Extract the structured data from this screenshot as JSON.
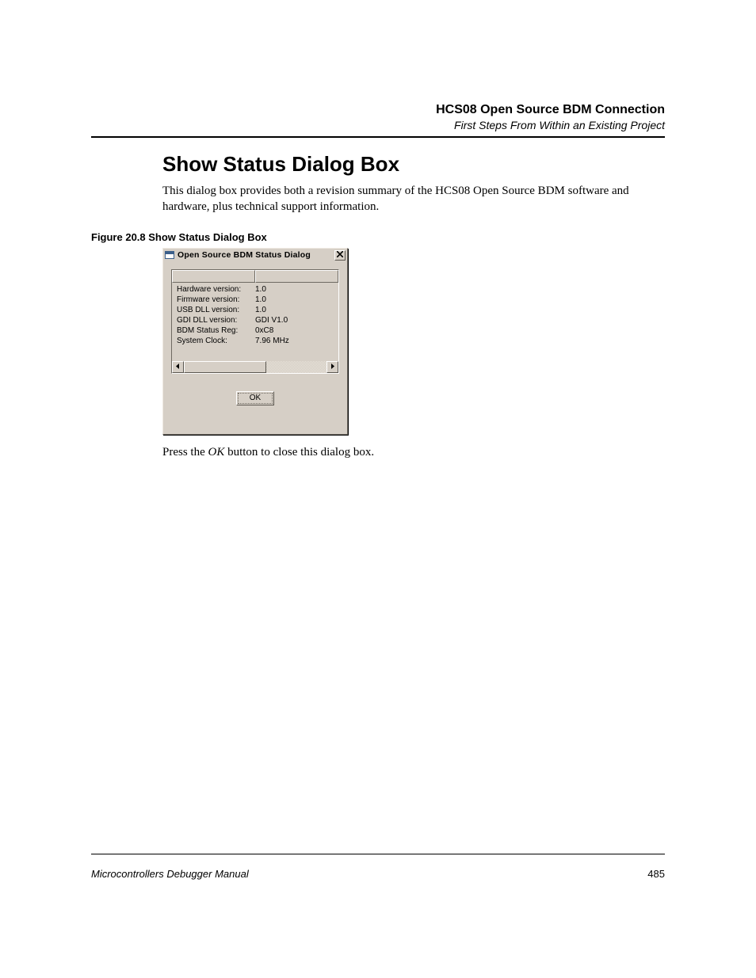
{
  "header": {
    "title": "HCS08 Open Source BDM Connection",
    "subtitle": "First Steps From Within an Existing Project"
  },
  "section_title": "Show Status Dialog Box",
  "intro_text": "This dialog box provides both a revision summary of the HCS08 Open Source BDM software and hardware, plus technical support information.",
  "figure_caption": "Figure 20.8  Show Status Dialog Box",
  "dialog": {
    "title": "Open Source BDM Status Dialog",
    "rows": [
      {
        "label": "Hardware version:",
        "value": "1.0"
      },
      {
        "label": "Firmware version:",
        "value": "1.0"
      },
      {
        "label": "USB DLL version:",
        "value": "1.0"
      },
      {
        "label": "GDI DLL version:",
        "value": "GDI V1.0"
      },
      {
        "label": "BDM Status Reg:",
        "value": "0xC8"
      },
      {
        "label": "System Clock:",
        "value": "7.96 MHz"
      }
    ],
    "ok_label": "OK"
  },
  "closing_pre": "Press the ",
  "closing_em": "OK",
  "closing_post": " button to close this dialog box.",
  "footer": {
    "left": "Microcontrollers Debugger Manual",
    "right": "485"
  }
}
